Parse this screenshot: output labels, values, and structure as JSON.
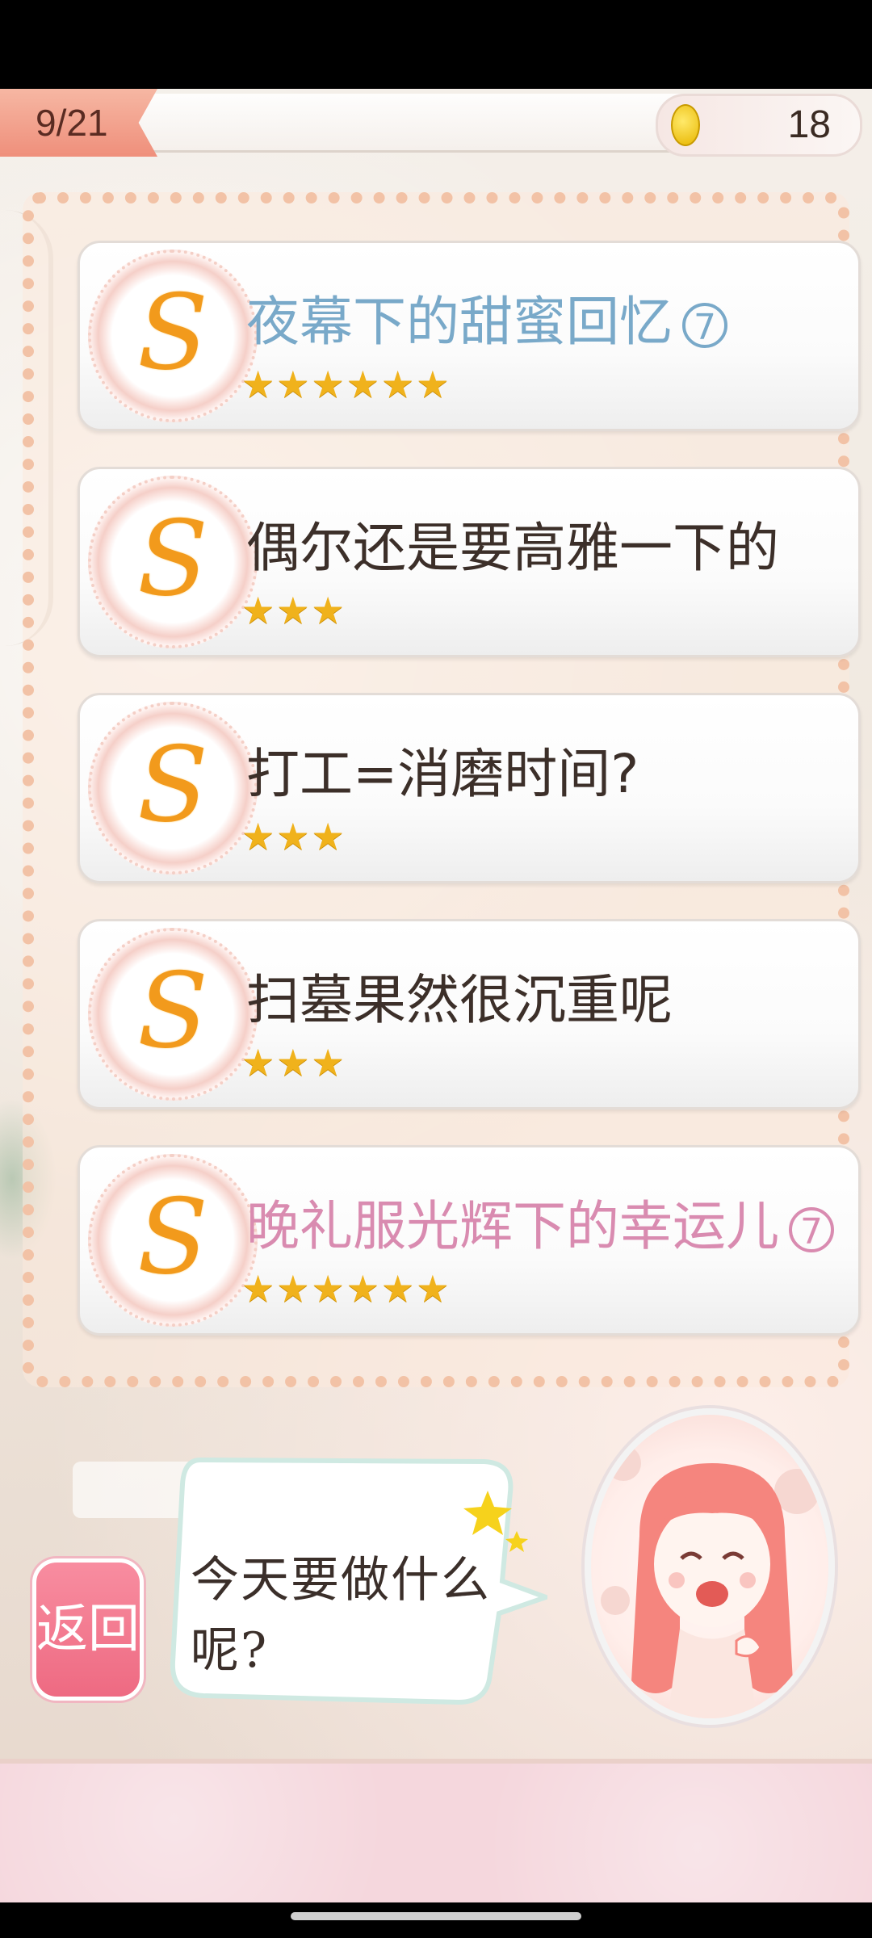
{
  "header": {
    "progress_label": "9/21",
    "coins": "18"
  },
  "tasks": [
    {
      "title": "夜幕下的甜蜜回忆",
      "badge": "7",
      "stars": "★★★★★★",
      "color": "#79a9c9"
    },
    {
      "title": "偶尔还是要高雅一下的",
      "stars": "★★★",
      "color": "#3c2f29"
    },
    {
      "title": "打工=消磨时间?",
      "stars": "★★★",
      "color": "#3c2f29"
    },
    {
      "title": "扫墓果然很沉重呢",
      "stars": "★★★",
      "color": "#3c2f29"
    },
    {
      "title": "晚礼服光辉下的幸运儿",
      "badge": "7",
      "stars": "★★★★★★",
      "color": "#d98bb0"
    }
  ],
  "dialog": {
    "text": "今天要做什么呢?"
  },
  "buttons": {
    "back": "返回"
  },
  "icons": {
    "task_icon": "s-swirl-icon",
    "coin": "coin-icon",
    "character": "girl-portrait-icon"
  }
}
